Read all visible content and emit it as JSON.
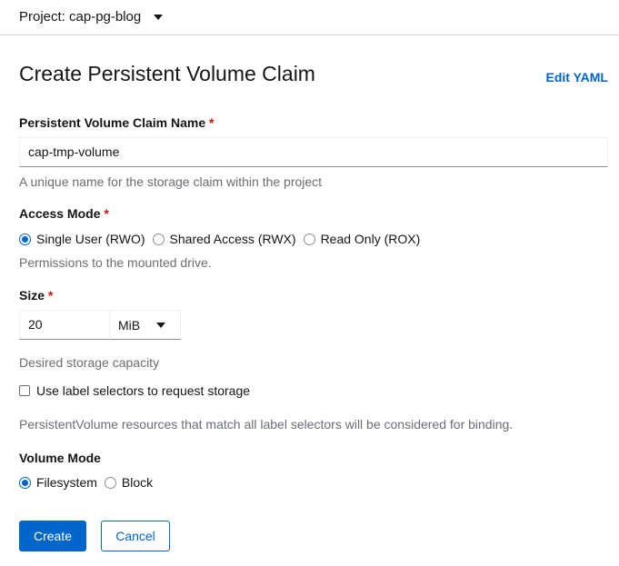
{
  "header": {
    "project_label": "Project: cap-pg-blog"
  },
  "page": {
    "title": "Create Persistent Volume Claim",
    "edit_yaml": "Edit YAML"
  },
  "name_field": {
    "label": "Persistent Volume Claim Name",
    "required": "*",
    "value": "cap-tmp-volume",
    "help": "A unique name for the storage claim within the project"
  },
  "access_mode": {
    "label": "Access Mode",
    "required": "*",
    "options": [
      "Single User (RWO)",
      "Shared Access (RWX)",
      "Read Only (ROX)"
    ],
    "selected": "Single User (RWO)",
    "help": "Permissions to the mounted drive."
  },
  "size": {
    "label": "Size",
    "required": "*",
    "value": "20",
    "unit": "MiB",
    "help": "Desired storage capacity"
  },
  "label_selector": {
    "label": "Use label selectors to request storage",
    "checked": false,
    "help": "PersistentVolume resources that match all label selectors will be considered for binding."
  },
  "volume_mode": {
    "label": "Volume Mode",
    "options": [
      "Filesystem",
      "Block"
    ],
    "selected": "Filesystem"
  },
  "actions": {
    "create": "Create",
    "cancel": "Cancel"
  },
  "colors": {
    "primary": "#0066cc",
    "required": "#c9190b"
  }
}
